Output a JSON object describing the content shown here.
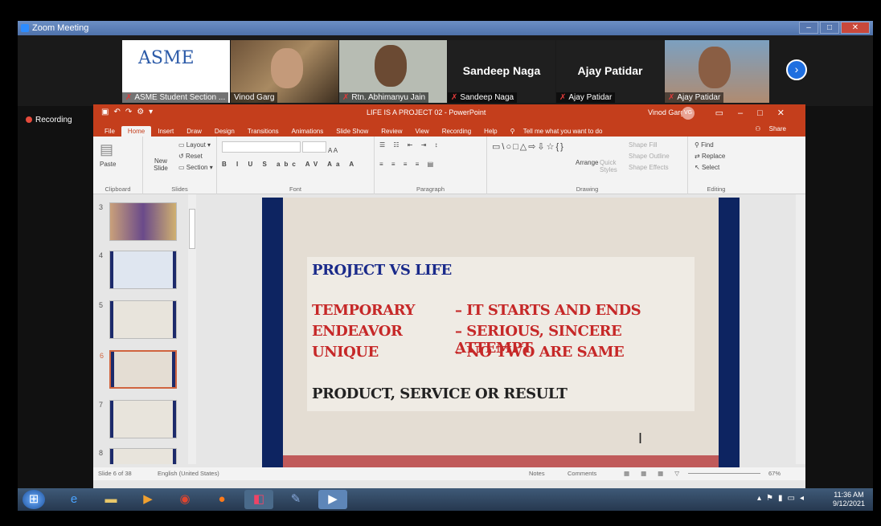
{
  "zoom": {
    "title": "Zoom Meeting",
    "recording": "Recording"
  },
  "participants": [
    {
      "name": "ASME Student Section ...",
      "logo": "ASME"
    },
    {
      "name": "Vinod Garg"
    },
    {
      "name": "Rtn. Abhimanyu Jain"
    },
    {
      "name": "Sandeep Naga",
      "display": "Sandeep Naga"
    },
    {
      "name": "Ajay Patidar",
      "display": "Ajay Patidar"
    },
    {
      "name": "Ajay Patidar"
    }
  ],
  "ppt": {
    "doc_title": "LIFE IS A PROJECT 02 - PowerPoint",
    "user": "Vinod Garg",
    "user_initials": "VG",
    "tabs": [
      "File",
      "Home",
      "Insert",
      "Draw",
      "Design",
      "Transitions",
      "Animations",
      "Slide Show",
      "Review",
      "View",
      "Recording",
      "Help"
    ],
    "tell_me": "Tell me what you want to do",
    "share": "Share",
    "ribbon": {
      "paste": "Paste",
      "clipboard": "Clipboard",
      "new_slide": "New Slide",
      "layout": "Layout",
      "reset": "Reset",
      "section": "Section",
      "slides": "Slides",
      "font": "Font",
      "paragraph": "Paragraph",
      "arrange": "Arrange",
      "quick_styles": "Quick Styles",
      "shape_fill": "Shape Fill",
      "shape_outline": "Shape Outline",
      "shape_effects": "Shape Effects",
      "drawing": "Drawing",
      "find": "Find",
      "replace": "Replace",
      "select": "Select",
      "editing": "Editing"
    },
    "slide_numbers": [
      "3",
      "4",
      "5",
      "6",
      "7",
      "8"
    ],
    "slide": {
      "heading": "PROJECT VS LIFE",
      "rows": [
        {
          "term": "TEMPORARY",
          "def": "– IT STARTS AND ENDS"
        },
        {
          "term": "ENDEAVOR",
          "def": "– SERIOUS, SINCERE ATTEMPT"
        },
        {
          "term": "UNIQUE",
          "def": "– NO TWO ARE SAME"
        }
      ],
      "footer": "PRODUCT, SERVICE OR RESULT"
    },
    "status": {
      "slide_of": "Slide 6 of 38",
      "language": "English (United States)",
      "notes": "Notes",
      "comments": "Comments",
      "zoom": "67%"
    }
  },
  "taskbar": {
    "time": "11:36 AM",
    "date": "9/12/2021"
  },
  "colors": {
    "ppt_red": "#c43e1c",
    "slide_blue": "#0d2461",
    "text_red": "#c62828",
    "heading_blue": "#1a2a8a"
  }
}
